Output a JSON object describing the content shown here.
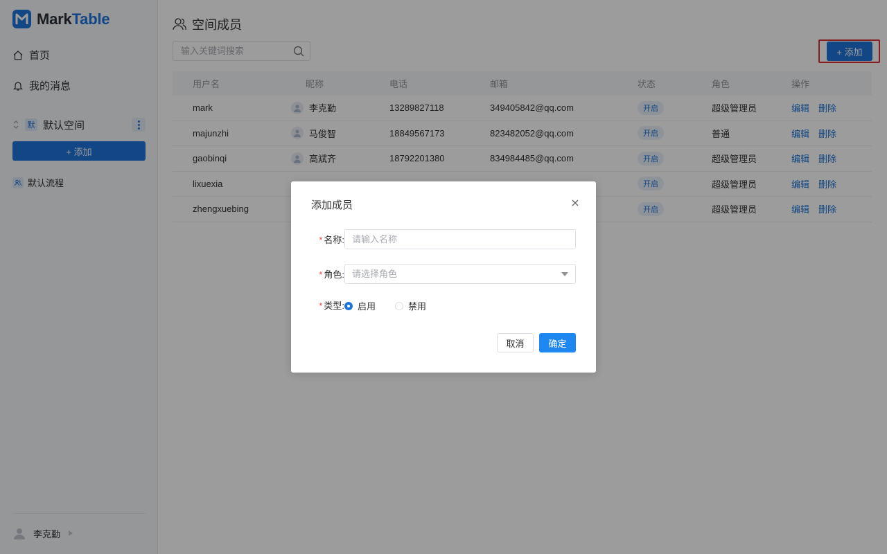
{
  "app": {
    "brand_part1": "Mark",
    "brand_part2": "Table",
    "brand_color": "#1e73d8"
  },
  "sidebar": {
    "nav": [
      {
        "label": "首页",
        "icon": "home-icon"
      },
      {
        "label": "我的消息",
        "icon": "bell-icon"
      }
    ],
    "space": {
      "badge": "默",
      "name": "默认空间"
    },
    "add_label": "+ 添加",
    "flows": [
      {
        "label": "默认流程",
        "icon": "flow-icon"
      }
    ],
    "user": {
      "name": "李克勤"
    }
  },
  "main": {
    "title": "空间成员",
    "search_placeholder": "输入关键词搜索",
    "add_label": "+ 添加",
    "table": {
      "headers": [
        "用户名",
        "昵称",
        "电话",
        "邮箱",
        "状态",
        "角色",
        "操作"
      ],
      "rows": [
        {
          "username": "mark",
          "nickname": "李克勤",
          "phone": "13289827118",
          "email": "349405842@qq.com",
          "status": "开启",
          "role": "超级管理员",
          "edit": "编辑",
          "delete": "删除"
        },
        {
          "username": "majunzhi",
          "nickname": "马俊智",
          "phone": "18849567173",
          "email": "823482052@qq.com",
          "status": "开启",
          "role": "普通",
          "edit": "编辑",
          "delete": "删除"
        },
        {
          "username": "gaobinqi",
          "nickname": "高斌齐",
          "phone": "18792201380",
          "email": "834984485@qq.com",
          "status": "开启",
          "role": "超级管理员",
          "edit": "编辑",
          "delete": "删除"
        },
        {
          "username": "lixuexia",
          "nickname": "",
          "phone": "",
          "email": "",
          "status": "开启",
          "role": "超级管理员",
          "edit": "编辑",
          "delete": "删除"
        },
        {
          "username": "zhengxuebing",
          "nickname": "",
          "phone": "",
          "email": "",
          "status": "开启",
          "role": "超级管理员",
          "edit": "编辑",
          "delete": "删除"
        }
      ]
    }
  },
  "dialog": {
    "title": "添加成员",
    "fields": {
      "name_label": "名称:",
      "name_placeholder": "请输入名称",
      "role_label": "角色:",
      "role_placeholder": "请选择角色",
      "type_label": "类型:",
      "type_options": [
        "启用",
        "禁用"
      ],
      "type_selected": "启用"
    },
    "cancel_label": "取消",
    "ok_label": "确定"
  },
  "colors": {
    "primary": "#1e73d8",
    "highlight_border": "#d8323a",
    "required_mark": "#e5484d"
  }
}
